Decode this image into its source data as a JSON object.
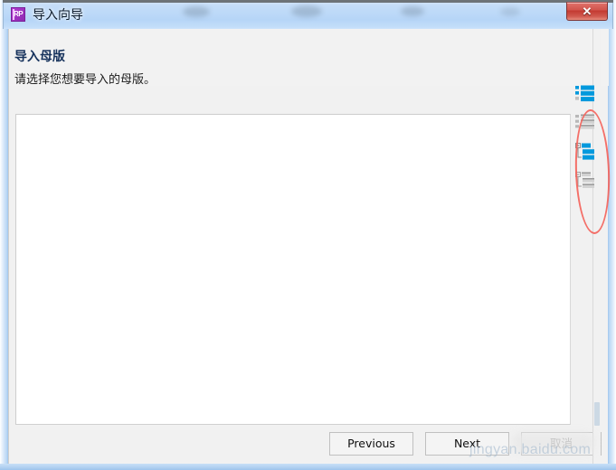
{
  "window": {
    "title": "导入向导",
    "app_icon_label": "RP",
    "close_label": "✕"
  },
  "header": {
    "title": "导入母版",
    "subtitle": "请选择您想要导入的母版。"
  },
  "list_panel": {
    "items": [],
    "empty_text": ""
  },
  "view_icons": [
    {
      "name": "list-view-icon",
      "state": "active",
      "color": "#0099dd"
    },
    {
      "name": "detail-view-icon",
      "state": "inactive",
      "color": "#9a9a9a"
    },
    {
      "name": "tree-view-icon",
      "state": "active",
      "color": "#0099dd"
    },
    {
      "name": "tree-detail-view-icon",
      "state": "inactive",
      "color": "#9a9a9a"
    }
  ],
  "annotation": {
    "shape": "ellipse",
    "color": "#f4645c"
  },
  "footer": {
    "previous_label": "Previous",
    "next_label": "Next",
    "cancel_label": "取消"
  },
  "watermark": {
    "text": "jingyan.baidu.com"
  },
  "colors": {
    "accent_blue": "#0099dd",
    "title_bar": "#bedaf8",
    "close_red": "#c33b32",
    "annotation_red": "#f4645c",
    "panel_bg": "#f1f1f1"
  }
}
